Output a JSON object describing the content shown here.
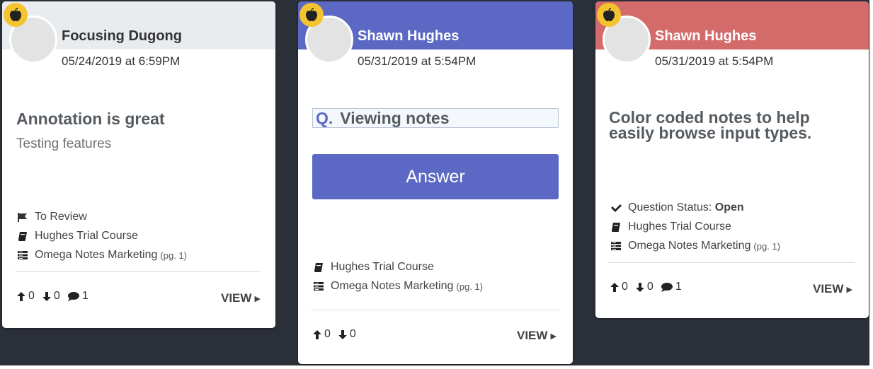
{
  "cards": [
    {
      "header_color": "#e9ecef",
      "name_color": "#333333",
      "author": "Focusing Dugong",
      "date": "05/24/2019 at 6:59PM",
      "title": "Annotation is great",
      "subtitle": "Testing features",
      "status": "To Review",
      "course": "Hughes Trial Course",
      "document": "Omega Notes Marketing",
      "page": "(pg. 1)",
      "upvotes": "0",
      "downvotes": "0",
      "comments": "1",
      "view_label": "VIEW"
    },
    {
      "header_color": "#5b68c4",
      "name_color": "#ffffff",
      "author": "Shawn Hughes",
      "date": "05/31/2019 at 5:54PM",
      "question_prefix": "Q.",
      "question": "Viewing notes",
      "answer_label": "Answer",
      "course": "Hughes Trial Course",
      "document": "Omega Notes Marketing",
      "page": "(pg. 1)",
      "upvotes": "0",
      "downvotes": "0",
      "view_label": "VIEW"
    },
    {
      "header_color": "#d46b6b",
      "name_color": "#ffffff",
      "author": "Shawn Hughes",
      "date": "05/31/2019 at 5:54PM",
      "title_line1": "Color coded notes to help",
      "title_line2": "easily browse input types.",
      "status_label": "Question Status:",
      "status_value": "Open",
      "course": "Hughes Trial Course",
      "document": "Omega Notes Marketing",
      "page": "(pg. 1)",
      "upvotes": "0",
      "downvotes": "0",
      "comments": "1",
      "view_label": "VIEW"
    }
  ],
  "icons": {
    "badge": "apple-icon",
    "flag": "flag-icon",
    "book": "book-icon",
    "document": "document-icon",
    "up": "arrow-up-icon",
    "down": "arrow-down-icon",
    "comment": "comment-icon",
    "check": "check-icon",
    "view": "caret-right-icon"
  }
}
